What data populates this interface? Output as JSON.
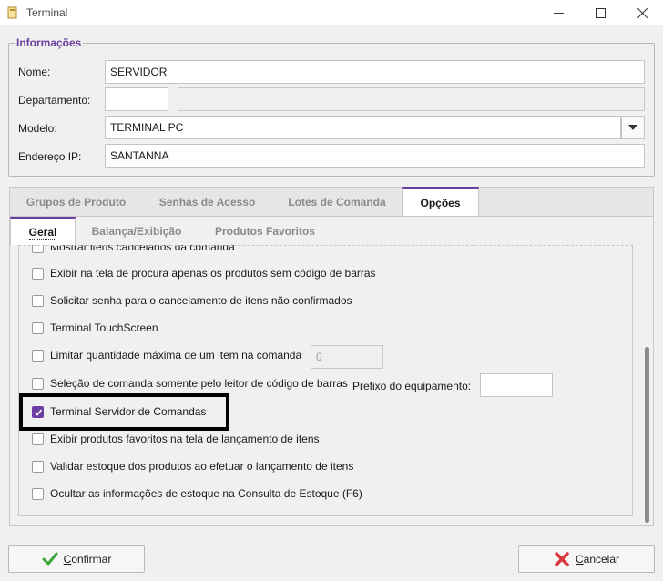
{
  "window": {
    "title": "Terminal"
  },
  "info": {
    "group_title": "Informações",
    "nome_label": "Nome:",
    "nome_value": "SERVIDOR",
    "departamento_label": "Departamento:",
    "departamento_code": "",
    "departamento_name": "",
    "modelo_label": "Modelo:",
    "modelo_value": "TERMINAL PC",
    "ip_label": "Endereço IP:",
    "ip_value": "SANTANNA"
  },
  "tabs": [
    "Grupos de Produto",
    "Senhas de Acesso",
    "Lotes de Comanda",
    "Opções"
  ],
  "active_tab": "Opções",
  "subtabs": [
    "Geral",
    "Balança/Exibição",
    "Produtos Favoritos"
  ],
  "active_subtab": "Geral",
  "options": [
    {
      "label": "Mostrar itens cancelados da comanda",
      "checked": false
    },
    {
      "label": "Exibir na tela de procura apenas os produtos sem código de barras",
      "checked": false
    },
    {
      "label": "Solicitar senha para o cancelamento de itens não confirmados",
      "checked": false
    },
    {
      "label": "Terminal TouchScreen",
      "checked": false
    },
    {
      "label": "Limitar quantidade máxima de um item na comanda",
      "checked": false
    },
    {
      "label": "Seleção de comanda somente pelo leitor de código de barras",
      "checked": false
    },
    {
      "label": "Terminal Servidor de Comandas",
      "checked": true
    },
    {
      "label": "Exibir produtos favoritos na tela de lançamento de itens",
      "checked": false
    },
    {
      "label": "Validar estoque dos produtos ao efetuar o lançamento de itens",
      "checked": false
    },
    {
      "label": "Ocultar as informações de estoque na Consulta de Estoque (F6)",
      "checked": false
    }
  ],
  "limit_qty_value": "0",
  "prefix_label": "Prefixo do equipamento:",
  "prefix_value": "",
  "buttons": {
    "confirm_first": "C",
    "confirm_rest": "onfirmar",
    "cancel_first": "C",
    "cancel_rest": "ancelar"
  },
  "colors": {
    "accent": "#6b3fa0",
    "confirm_icon": "#3aa63a",
    "cancel_icon": "#d9363e"
  }
}
